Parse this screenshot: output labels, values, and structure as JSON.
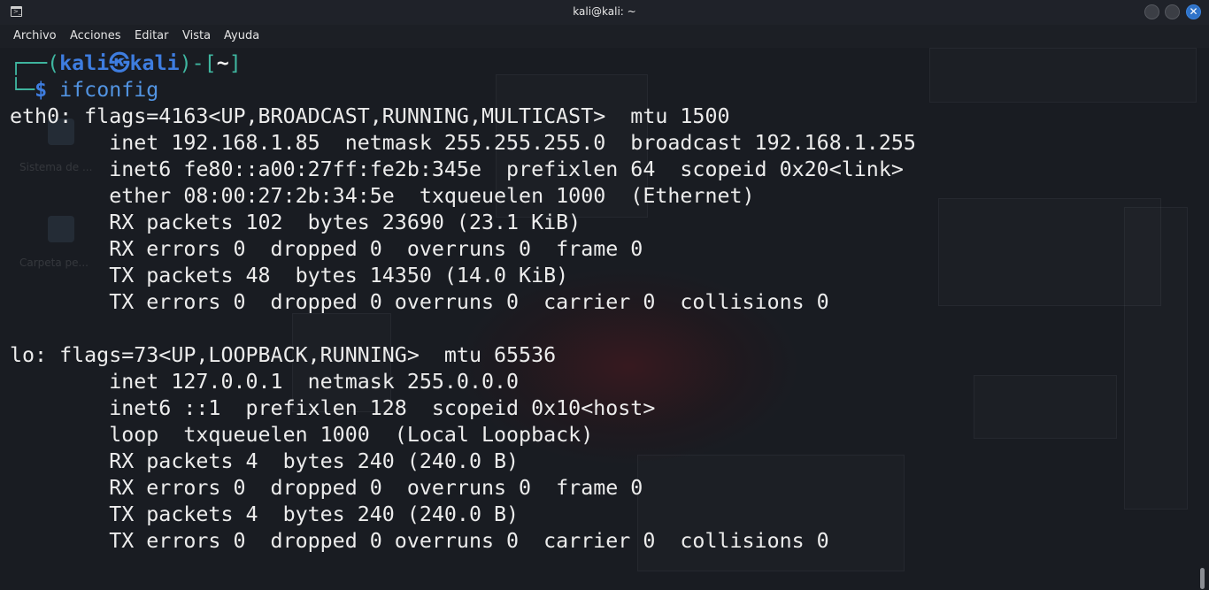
{
  "window": {
    "title": "kali@kali: ~",
    "icon": "terminal-icon",
    "controls": [
      "minimize-icon",
      "maximize-icon",
      "close-icon"
    ],
    "close_glyph": "✕",
    "accent_color": "#2f73c9"
  },
  "menu": {
    "items": [
      "Archivo",
      "Acciones",
      "Editar",
      "Vista",
      "Ayuda"
    ]
  },
  "prompt": {
    "corner_top": "┌──(",
    "user": "kali",
    "at_symbol": "㉿",
    "host": "kali",
    "close_paren": ")-[",
    "cwd": "~",
    "close_bracket": "]",
    "corner_bottom": "└─",
    "dollar": "$",
    "command": "ifconfig"
  },
  "output": [
    "eth0: flags=4163<UP,BROADCAST,RUNNING,MULTICAST>  mtu 1500",
    "        inet 192.168.1.85  netmask 255.255.255.0  broadcast 192.168.1.255",
    "        inet6 fe80::a00:27ff:fe2b:345e  prefixlen 64  scopeid 0x20<link>",
    "        ether 08:00:27:2b:34:5e  txqueuelen 1000  (Ethernet)",
    "        RX packets 102  bytes 23690 (23.1 KiB)",
    "        RX errors 0  dropped 0  overruns 0  frame 0",
    "        TX packets 48  bytes 14350 (14.0 KiB)",
    "        TX errors 0  dropped 0 overruns 0  carrier 0  collisions 0",
    "",
    "lo: flags=73<UP,LOOPBACK,RUNNING>  mtu 65536",
    "        inet 127.0.0.1  netmask 255.0.0.0",
    "        inet6 ::1  prefixlen 128  scopeid 0x10<host>",
    "        loop  txqueuelen 1000  (Local Loopback)",
    "        RX packets 4  bytes 240 (240.0 B)",
    "        RX errors 0  dropped 0  overruns 0  frame 0",
    "        TX packets 4  bytes 240 (240.0 B)",
    "        TX errors 0  dropped 0 overruns 0  carrier 0  collisions 0"
  ],
  "desktop": {
    "icon_labels": [
      "Sistema de ...",
      "Carpeta pe..."
    ]
  },
  "colors": {
    "background": "#191c22",
    "prompt_blue": "#3e7de0",
    "command_blue": "#5294e2",
    "text": "#ececec"
  }
}
